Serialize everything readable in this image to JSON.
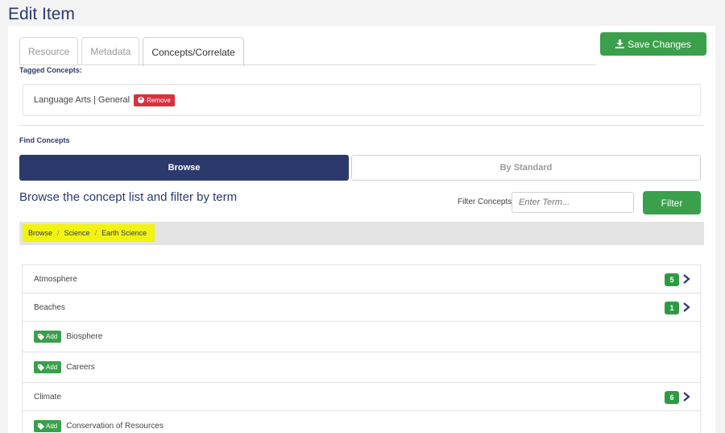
{
  "page": {
    "title": "Edit Item"
  },
  "tabs": [
    {
      "label": "Resource",
      "active": false
    },
    {
      "label": "Metadata",
      "active": false
    },
    {
      "label": "Concepts/Correlate",
      "active": true
    }
  ],
  "toolbar": {
    "save_label": "Save Changes",
    "save_icon": "download-icon"
  },
  "tagged": {
    "heading": "Tagged Concepts:",
    "items": [
      {
        "label": "Language Arts | General",
        "remove_label": "Remove"
      }
    ]
  },
  "find": {
    "heading": "Find Concepts",
    "modes": [
      {
        "label": "Browse",
        "active": true
      },
      {
        "label": "By Standard",
        "active": false
      }
    ],
    "browse_heading": "Browse the concept list and filter by term",
    "filter_label": "Filter Concepts",
    "filter_placeholder": "Enter Term...",
    "filter_button": "Filter"
  },
  "breadcrumb": [
    "Browse",
    "Science",
    "Earth Science"
  ],
  "concepts": [
    {
      "label": "Atmosphere",
      "count": "5",
      "has_children": true
    },
    {
      "label": "Beaches",
      "count": "1",
      "has_children": true
    },
    {
      "label": "Biosphere",
      "add_label": "Add",
      "has_children": false
    },
    {
      "label": "Careers",
      "add_label": "Add",
      "has_children": false
    },
    {
      "label": "Climate",
      "count": "6",
      "has_children": true
    },
    {
      "label": "Conservation of Resources",
      "add_label": "Add",
      "has_children": false
    }
  ],
  "colors": {
    "primary": "#2b3a6b",
    "success": "#3aa04b",
    "danger": "#d8323f",
    "highlight": "#f3f311"
  }
}
